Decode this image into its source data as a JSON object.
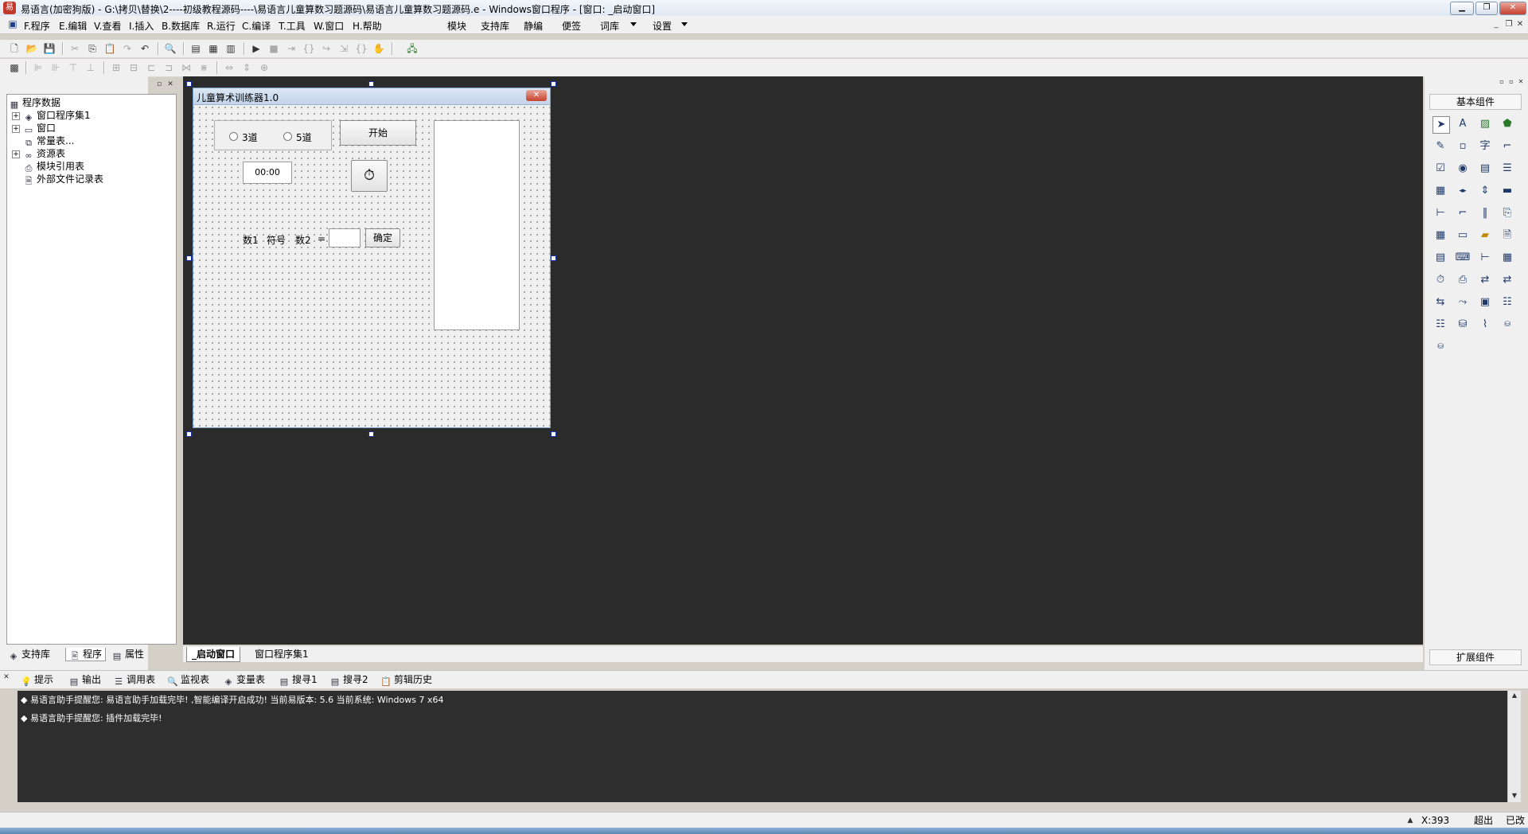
{
  "window": {
    "title": "易语言(加密狗版) - G:\\拷贝\\替换\\2----初级教程源码----\\易语言儿童算数习题源码\\易语言儿童算数习题源码.e - Windows窗口程序 - [窗口: _启动窗口]",
    "app_icon": "易"
  },
  "menu": {
    "items": [
      "F.程序",
      "E.编辑",
      "V.查看",
      "I.插入",
      "B.数据库",
      "R.运行",
      "C.编译",
      "T.工具",
      "W.窗口",
      "H.帮助"
    ],
    "right_items": [
      "模块",
      "支持库",
      "静编",
      "便签",
      "词库",
      "设置"
    ]
  },
  "left_panel": {
    "root": "程序数据",
    "tree": [
      {
        "label": "窗口程序集1",
        "icon": "module-icon",
        "expandable": true
      },
      {
        "label": "窗口",
        "icon": "window-icon",
        "expandable": true
      },
      {
        "label": "常量表...",
        "icon": "constant-icon",
        "expandable": false
      },
      {
        "label": "资源表",
        "icon": "resource-icon",
        "expandable": true
      },
      {
        "label": "模块引用表",
        "icon": "module-ref-icon",
        "expandable": false
      },
      {
        "label": "外部文件记录表",
        "icon": "file-icon",
        "expandable": false
      }
    ],
    "tabs": [
      "支持库",
      "程序",
      "属性"
    ]
  },
  "design": {
    "tabs": [
      "_启动窗口",
      "窗口程序集1"
    ],
    "form": {
      "title": "儿童算术训练器1.0",
      "radio1": "3道",
      "radio2": "5道",
      "start_button": "开始",
      "timer_value": "00:00",
      "label_num1": "数1",
      "label_sign": "符号",
      "label_num2": "数2",
      "label_equals": "=",
      "answer_value": "",
      "confirm_button": "确定"
    }
  },
  "right_panel": {
    "basic_group": "基本组件",
    "extended_group": "扩展组件"
  },
  "output_tabs": [
    "提示",
    "输出",
    "调用表",
    "监视表",
    "变量表",
    "搜寻1",
    "搜寻2",
    "剪辑历史"
  ],
  "output_lines": [
    "◆ 易语言助手提醒您: 易语言助手加载完毕! ,智能编译开启成功! 当前易版本: 5.6 当前系统: Windows 7 x64",
    "◆ 易语言助手提醒您: 插件加载完毕!"
  ],
  "status": {
    "coordinate": "X:393",
    "mode": "超出",
    "state": "已改"
  }
}
